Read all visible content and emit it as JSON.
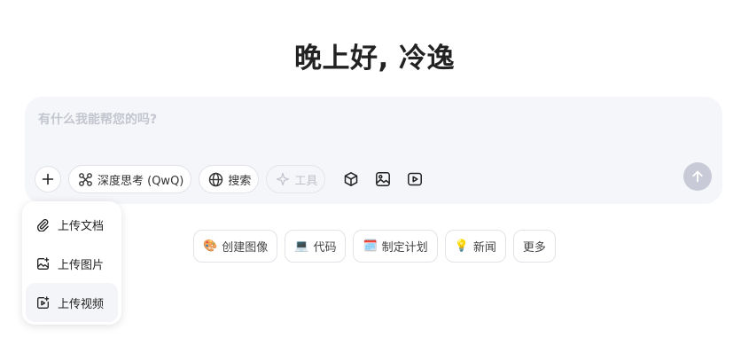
{
  "greeting": "晚上好, 冷逸",
  "composer": {
    "placeholder": "有什么我能帮您的吗?",
    "value": ""
  },
  "toolbar": {
    "add_icon": "plus-icon",
    "deep_think_label": "深度思考 (QwQ)",
    "search_label": "搜索",
    "tools_label": "工具",
    "artifact_icon": "cube-icon",
    "image_icon": "image-icon",
    "video_icon": "play-square-icon",
    "send_icon": "arrow-up-icon"
  },
  "suggestions": [
    {
      "emoji": "🎨",
      "label": "创建图像"
    },
    {
      "emoji": "💻",
      "label": "代码"
    },
    {
      "emoji": "🗓️",
      "label": "制定计划"
    },
    {
      "emoji": "💡",
      "label": "新闻"
    },
    {
      "emoji": "",
      "label": "更多"
    }
  ],
  "upload_menu": [
    {
      "icon": "paperclip-icon",
      "label": "上传文档"
    },
    {
      "icon": "image-plus-icon",
      "label": "上传图片"
    },
    {
      "icon": "video-plus-icon",
      "label": "上传视频"
    }
  ],
  "colors": {
    "composer_bg": "#f5f6fa",
    "send_button": "#c9cad7",
    "disabled_text": "#bfc1c9"
  }
}
